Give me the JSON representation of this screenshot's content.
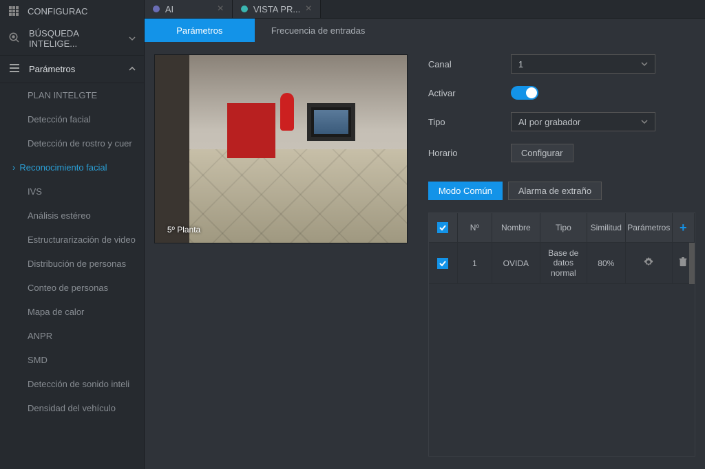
{
  "header": {
    "title": "CONFIGURAC"
  },
  "sidebar": {
    "smart_search": "BÚSQUEDA INTELIGE...",
    "parameters": "Parámetros",
    "items": [
      "PLAN INTELGTE",
      "Detección facial",
      "Detección de rostro y cuer",
      "Reconocimiento facial",
      "IVS",
      "Análisis estéreo",
      "Estructurarización de video",
      "Distribución de personas",
      "Conteo de personas",
      "Mapa de calor",
      "ANPR",
      "SMD",
      "Detección de sonido inteli",
      "Densidad del vehículo"
    ]
  },
  "tabs_top": [
    {
      "label": "AI"
    },
    {
      "label": "VISTA PR..."
    }
  ],
  "sub_tabs": {
    "parametros": "Parámetros",
    "frecuencia": "Frecuencia de entradas"
  },
  "camera": {
    "label": "5º Planta"
  },
  "form": {
    "canal_label": "Canal",
    "canal_value": "1",
    "activar_label": "Activar",
    "tipo_label": "Tipo",
    "tipo_value": "AI por grabador",
    "horario_label": "Horario",
    "horario_button": "Configurar"
  },
  "modes": {
    "comun": "Modo Común",
    "extrano": "Alarma de extraño"
  },
  "table": {
    "headers": {
      "num": "Nº",
      "nombre": "Nombre",
      "tipo": "Tipo",
      "similitud": "Similitud",
      "parametros": "Parámetros"
    },
    "rows": [
      {
        "num": "1",
        "nombre": "OVIDA",
        "tipo": "Base de datos normal",
        "similitud": "80%"
      }
    ]
  }
}
